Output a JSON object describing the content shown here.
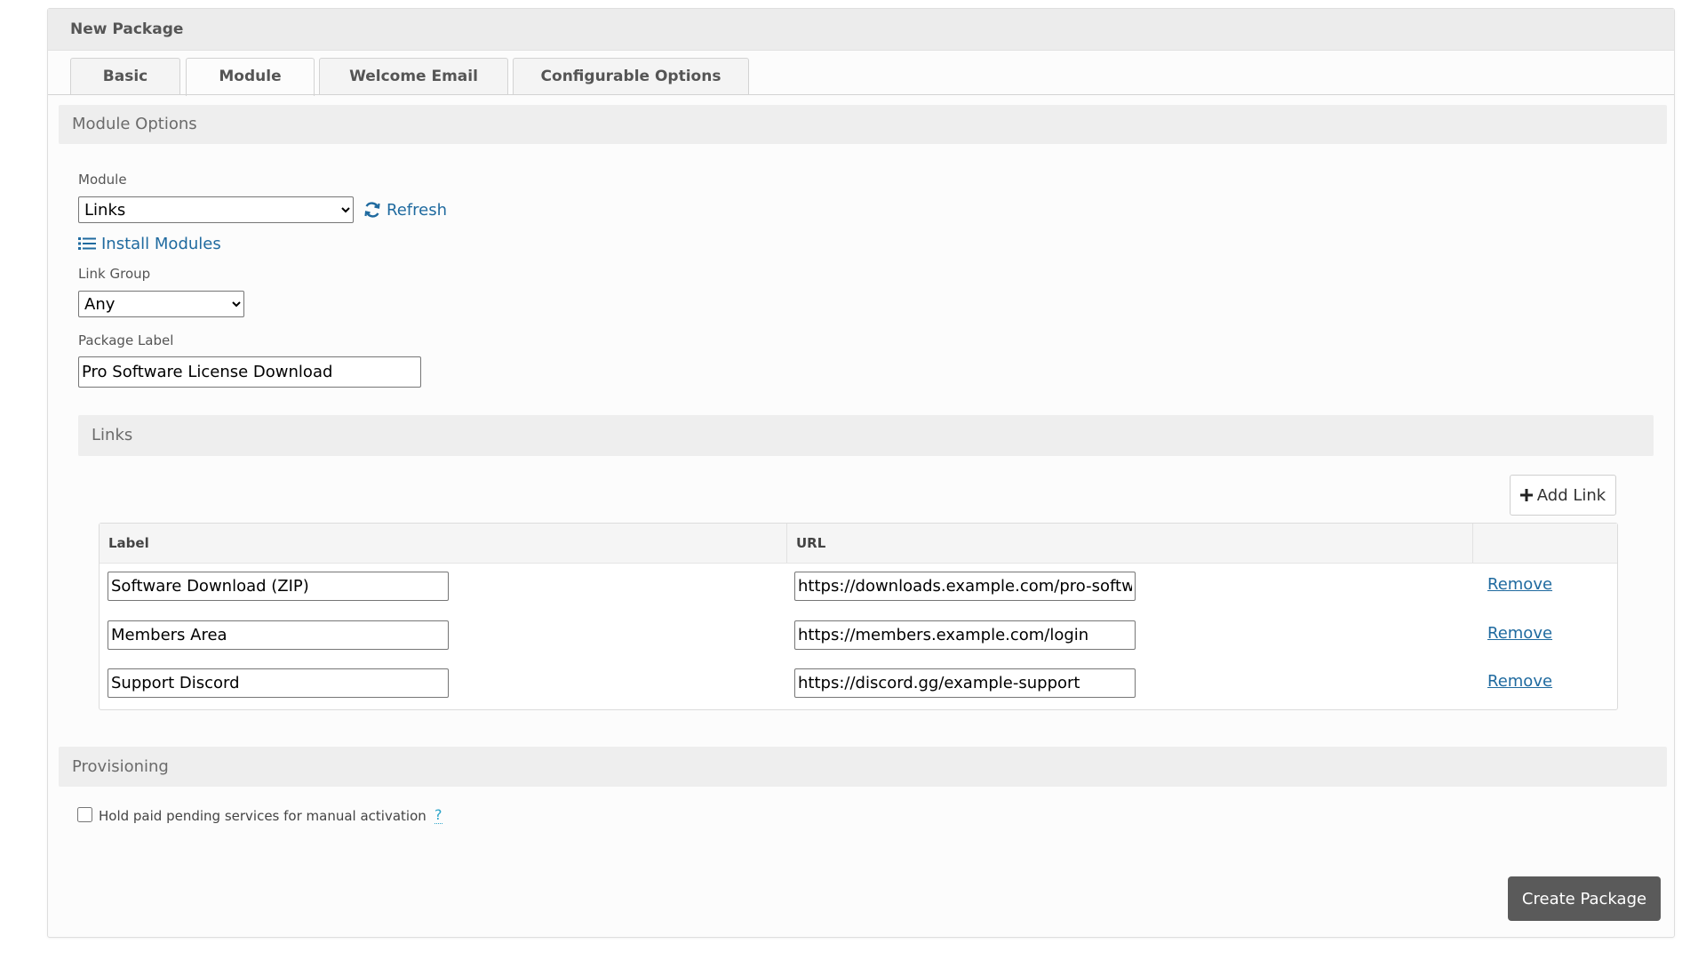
{
  "panel": {
    "title": "New Package"
  },
  "tabs": [
    {
      "label": "Basic"
    },
    {
      "label": "Module"
    },
    {
      "label": "Welcome Email"
    },
    {
      "label": "Configurable Options"
    }
  ],
  "module_options": {
    "heading": "Module Options",
    "module_label": "Module",
    "module_value": "Links",
    "refresh_label": "Refresh",
    "install_label": "Install Modules",
    "link_group_label": "Link Group",
    "link_group_value": "Any",
    "package_label_label": "Package Label",
    "package_label_value": "Pro Software License Download"
  },
  "links": {
    "heading": "Links",
    "add_label": "Add Link",
    "col_label": "Label",
    "col_url": "URL",
    "remove_label": "Remove",
    "rows": [
      {
        "label": "Software Download (ZIP)",
        "url": "https://downloads.example.com/pro-software.zip"
      },
      {
        "label": "Members Area",
        "url": "https://members.example.com/login"
      },
      {
        "label": "Support Discord",
        "url": "https://discord.gg/example-support"
      }
    ]
  },
  "provisioning": {
    "heading": "Provisioning",
    "hold_label": "Hold paid pending services for manual activation",
    "hold_checked": false,
    "help_label": "?"
  },
  "footer": {
    "create_label": "Create Package"
  },
  "colors": {
    "link": "#1f6a9f",
    "help": "#2aa4c9",
    "primary_button": "#5a5a5a"
  },
  "icons": [
    "refresh-icon",
    "list-icon",
    "plus-icon"
  ]
}
